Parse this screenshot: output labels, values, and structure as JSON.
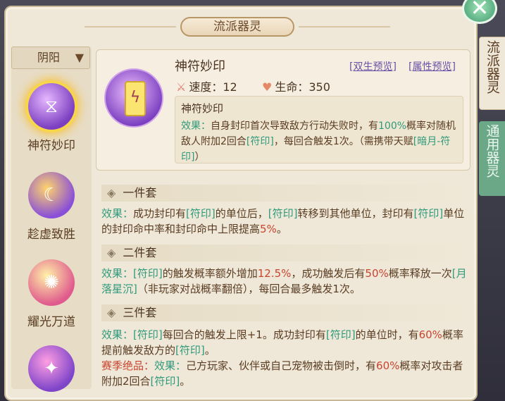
{
  "window": {
    "title": "流派器灵"
  },
  "close_icon": "close-icon",
  "sidebar": {
    "dropdown": "阴阳",
    "items": [
      {
        "label": "神符妙印",
        "icon": "talisman-icon"
      },
      {
        "label": "趁虚致胜",
        "icon": "moon-icon"
      },
      {
        "label": "耀光万道",
        "icon": "sun-icon"
      },
      {
        "label": "",
        "icon": "star-icon"
      }
    ]
  },
  "right_tabs": [
    {
      "label": "流派器灵",
      "active": true
    },
    {
      "label": "通用器灵",
      "active": false
    }
  ],
  "detail": {
    "name": "神符妙印",
    "twin_preview": "[双生预览]",
    "attr_preview": "[属性预览]",
    "speed_label": "速度：",
    "speed_value": "12",
    "life_label": "生命：",
    "life_value": "350",
    "desc_title": "神符妙印",
    "desc_parts": {
      "prefix": "效果：",
      "p1": "自身封印首次导致敌方行动失败时，有",
      "pct": "100%",
      "p2": "概率对随机敌人附加2回合",
      "tag": "[符印]",
      "p3": "，每回合触发1次。（需携带天赋",
      "talent": "[暗月-符印]",
      "p4": "）"
    }
  },
  "sets": [
    {
      "title": "一件套",
      "parts": {
        "prefix": "效果：",
        "a": "成功封印有",
        "tag1": "[符印]",
        "b": "的单位后，",
        "tag2": "[符印]",
        "c": "转移到其他单位，封印有",
        "tag3": "[符印]",
        "d": "单位的封印命中率和封印命中上限提高",
        "pct": "5%",
        "e": "。"
      }
    },
    {
      "title": "二件套",
      "parts": {
        "prefix": "效果：",
        "tag1": "[符印]",
        "a": "的触发概率额外增加",
        "pct1": "12.5%",
        "b": "，成功触发后有",
        "pct2": "50%",
        "c": "概率释放一次",
        "tag2": "[月落星沉]",
        "d": "（非玩家对战概率翻倍），每回合最多触发1次。"
      }
    },
    {
      "title": "三件套",
      "parts": {
        "prefix": "效果：",
        "tag1": "[符印]",
        "a": "每回合的触发上限+1。成功封印有",
        "tag2": "[符印]",
        "b": "的单位时，有",
        "pct1": "60%",
        "c": "概率提前触发敌方的",
        "tag3": "[符印]",
        "d": "。",
        "season_label": "赛季绝品：",
        "prefix2": "效果：",
        "e": "己方玩家、伙伴或自己宠物被击倒时，有",
        "pct2": "60%",
        "f": "概率对攻击者附加2回合",
        "tag4": "[符印]",
        "g": "。"
      }
    }
  ]
}
